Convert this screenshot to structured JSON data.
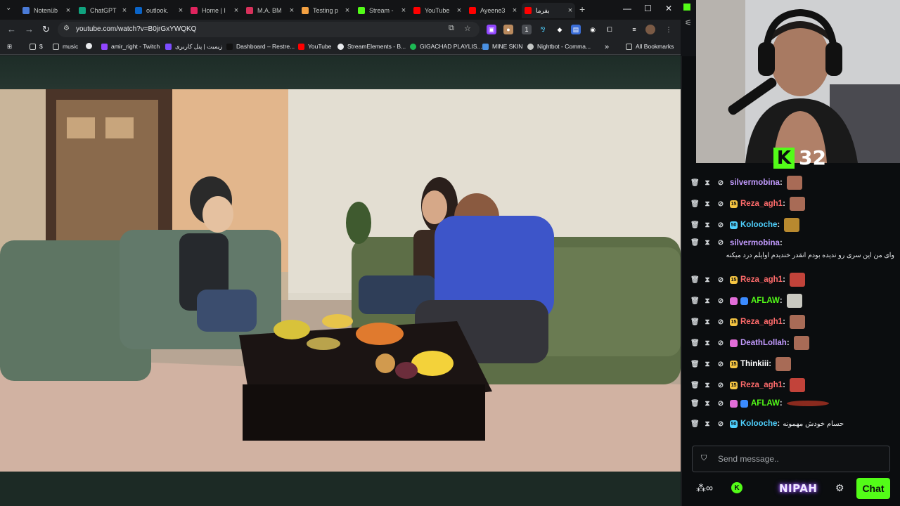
{
  "browser": {
    "tabs": [
      {
        "title": "Notenüb",
        "color": "#4a7bd8"
      },
      {
        "title": "ChatGPT",
        "color": "#10a37f"
      },
      {
        "title": "outlook.",
        "color": "#0a64c8"
      },
      {
        "title": "Home | I",
        "color": "#e0245e"
      },
      {
        "title": "M.A. BM",
        "color": "#d8315b"
      },
      {
        "title": "Testing p",
        "color": "#f4a142"
      },
      {
        "title": "Stream -",
        "color": "#53fc18"
      },
      {
        "title": "YouTube",
        "color": "#ff0000"
      },
      {
        "title": "Ayeene3",
        "color": "#ff0000"
      },
      {
        "title": "بفرما",
        "color": "#ff0000",
        "active": true
      }
    ],
    "url": "youtube.com/watch?v=B0jrGxYWQKQ",
    "bookmarks": [
      {
        "label": "$",
        "color": "#c4c7c5"
      },
      {
        "label": "music",
        "color": "#c4c7c5"
      },
      {
        "label": "",
        "color": "#e8eaed"
      },
      {
        "label": "amir_right - Twitch",
        "color": "#9146ff"
      },
      {
        "label": "زیمیت | پنل کاربری",
        "color": "#7c4dff"
      },
      {
        "label": "Dashboard – Restre...",
        "color": "#ffffff"
      },
      {
        "label": "YouTube",
        "color": "#ff0000"
      },
      {
        "label": "StreamElements - B...",
        "color": "#e8eaed"
      },
      {
        "label": "GIGACHAD PLAYLIS...",
        "color": "#1db954"
      },
      {
        "label": "MINE SKIN",
        "color": "#4a90e2"
      },
      {
        "label": "Nightbot - Comma...",
        "color": "#c4c7c5"
      }
    ],
    "all_bookmarks": "All Bookmarks",
    "more_bookmarks": "»"
  },
  "overlay": {
    "viewer_count": "32",
    "kick_letter": "K"
  },
  "chat": {
    "messages": [
      {
        "user": "silvermobina",
        "color": "#c39bff",
        "badge": "",
        "text": ""
      },
      {
        "user": "Reza_agh1",
        "color": "#ff6b6b",
        "badge": "15",
        "text": ""
      },
      {
        "user": "Kolooche",
        "color": "#4fd1ff",
        "badge": "50",
        "text": ""
      },
      {
        "user": "silvermobina",
        "color": "#c39bff",
        "badge": "",
        "text": "وای من این سری رو ندیده بودم انقدر خندیدم اوایلم درد میکنه"
      },
      {
        "user": "Reza_agh1",
        "color": "#ff6b6b",
        "badge": "15",
        "text": ""
      },
      {
        "user": "AFLAW",
        "color": "#53fc18",
        "badge": "",
        "text": ""
      },
      {
        "user": "Reza_agh1",
        "color": "#ff6b6b",
        "badge": "15",
        "text": ""
      },
      {
        "user": "DeathLollah",
        "color": "#c39bff",
        "badge": "",
        "text": ""
      },
      {
        "user": "Thinkiii",
        "color": "#ffffff",
        "badge": "15",
        "text": ""
      },
      {
        "user": "Reza_agh1",
        "color": "#ff6b6b",
        "badge": "15",
        "text": ""
      },
      {
        "user": "AFLAW",
        "color": "#53fc18",
        "badge": "",
        "text": ""
      },
      {
        "user": "Kolooche",
        "color": "#4fd1ff",
        "badge": "50",
        "text": "حسام خودش مهمونه"
      }
    ],
    "placeholder": "Send message..",
    "send_label": "Chat",
    "brand": "NIPAH"
  }
}
